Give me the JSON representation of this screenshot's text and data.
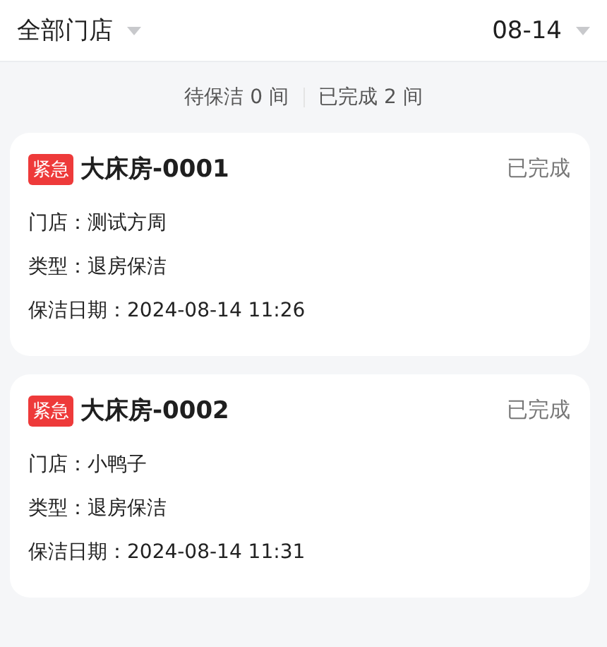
{
  "filters": [
    {
      "label": "全部门店"
    },
    {
      "label": "08-14"
    }
  ],
  "summary": [
    "待保洁 0 间",
    "已完成 2 间"
  ],
  "rooms": [
    {
      "tag": "紧急",
      "urgent": true,
      "name": "大床房-0001",
      "status": "已完成",
      "details": [
        "门店：测试方周",
        "类型：退房保洁",
        "保洁日期：2024-08-14 11:26"
      ]
    },
    {
      "tag": "紧急",
      "urgent": true,
      "name": "大床房-0002",
      "status": "已完成",
      "details": [
        "门店：小鸭子",
        "类型：退房保洁",
        "保洁日期：2024-08-14 11:31"
      ]
    }
  ]
}
